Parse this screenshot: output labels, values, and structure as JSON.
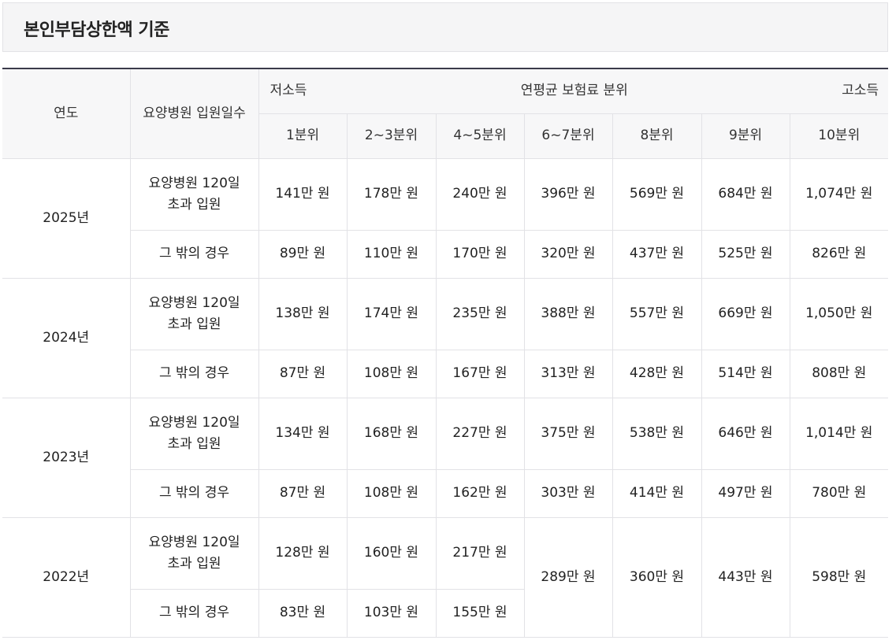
{
  "title": "본인부담상한액 기준",
  "header": {
    "year": "연도",
    "days": "요양병원 입원일수",
    "group_low": "저소득",
    "group_mid": "연평균 보험료 분위",
    "group_high": "고소득",
    "deciles": [
      "1분위",
      "2~3분위",
      "4~5분위",
      "6~7분위",
      "8분위",
      "9분위",
      "10분위"
    ]
  },
  "row_labels": {
    "over": "요양병원 120일\n초과 입원",
    "other": "그 밖의 경우"
  },
  "rows": [
    {
      "year": "2025년",
      "over": [
        "141만 원",
        "178만 원",
        "240만 원",
        "396만 원",
        "569만 원",
        "684만 원",
        "1,074만 원"
      ],
      "other": [
        "89만 원",
        "110만 원",
        "170만 원",
        "320만 원",
        "437만 원",
        "525만 원",
        "826만 원"
      ]
    },
    {
      "year": "2024년",
      "over": [
        "138만 원",
        "174만 원",
        "235만 원",
        "388만 원",
        "557만 원",
        "669만 원",
        "1,050만 원"
      ],
      "other": [
        "87만 원",
        "108만 원",
        "167만 원",
        "313만 원",
        "428만 원",
        "514만 원",
        "808만 원"
      ]
    },
    {
      "year": "2023년",
      "over": [
        "134만 원",
        "168만 원",
        "227만 원",
        "375만 원",
        "538만 원",
        "646만 원",
        "1,014만 원"
      ],
      "other": [
        "87만 원",
        "108만 원",
        "162만 원",
        "303만 원",
        "414만 원",
        "497만 원",
        "780만 원"
      ]
    },
    {
      "year": "2022년",
      "over": [
        "128만 원",
        "160만 원",
        "217만 원"
      ],
      "other": [
        "83만 원",
        "103만 원",
        "155만 원"
      ],
      "shared": [
        "289만 원",
        "360만 원",
        "443만 원",
        "598만 원"
      ]
    }
  ]
}
